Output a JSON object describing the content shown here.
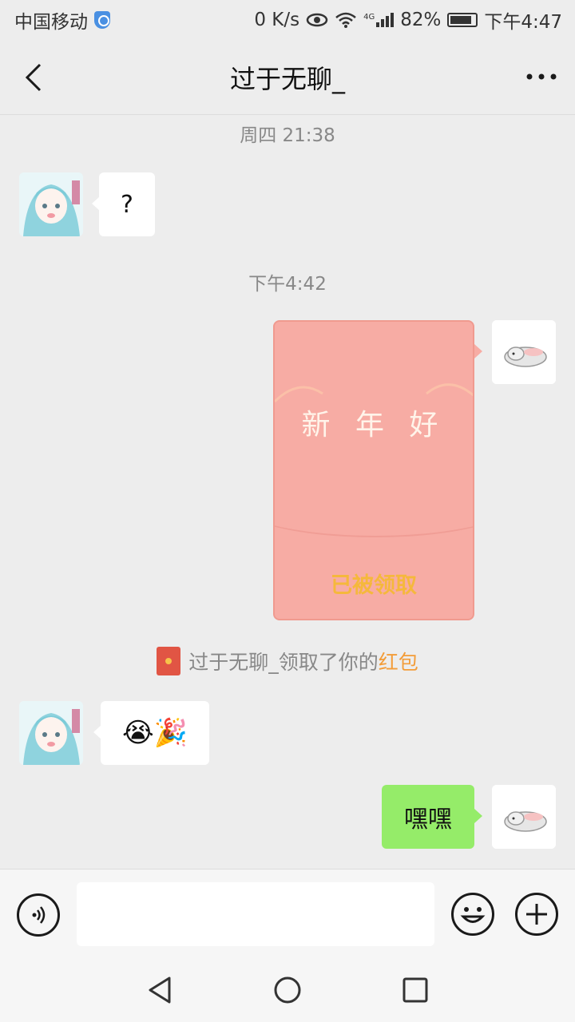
{
  "status_bar": {
    "carrier": "中国移动",
    "net_speed": "0 K/s",
    "signal_label": "4G",
    "battery": "82%",
    "time": "下午4:47"
  },
  "header": {
    "title": "过于无聊_",
    "back_icon": "chevron-left-icon",
    "more_icon": "more-dots-icon"
  },
  "messages": {
    "timestamp_1": "周四 21:38",
    "msg_1_text": "?",
    "timestamp_2": "下午4:42",
    "red_packet": {
      "greeting": "新 年 好",
      "status": "已被领取"
    },
    "system_notice": {
      "prefix": "过于无聊_领取了你的",
      "highlight": "红包"
    },
    "msg_3_emojis": "😭🎉",
    "msg_4_text": "嘿嘿"
  },
  "input_bar": {
    "placeholder": "",
    "voice_icon": "voice-icon",
    "emoji_icon": "smiley-icon",
    "plus_icon": "plus-icon"
  },
  "colors": {
    "self_bubble": "#95ec69",
    "red_packet": "#f7aca4",
    "highlight": "#f39c38"
  }
}
